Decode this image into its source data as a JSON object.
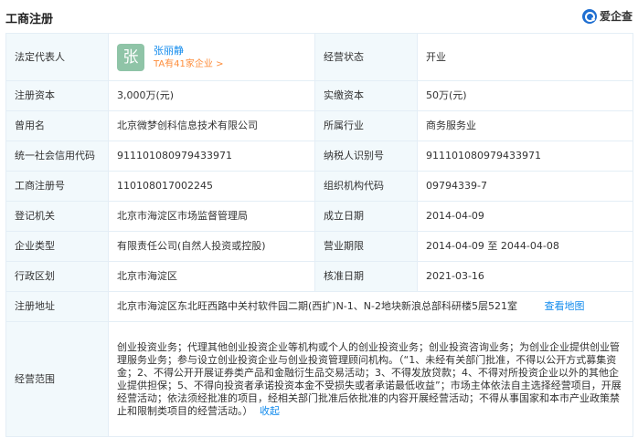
{
  "header": {
    "title": "工商注册",
    "brand": "爱企查",
    "brand_icon": "magnifier-logo-icon"
  },
  "rep": {
    "label": "法定代表人",
    "avatar_char": "张",
    "name": "张丽静",
    "companies_link": "TA有41家企业 >",
    "status_label": "经营状态",
    "status_value": "开业"
  },
  "rows": {
    "capital": {
      "l1": "注册资本",
      "v1": "3,000万(元)",
      "l2": "实缴资本",
      "v2": "50万(元)"
    },
    "former": {
      "l1": "曾用名",
      "v1": "北京微梦创科信息技术有限公司",
      "l2": "所属行业",
      "v2": "商务服务业"
    },
    "credit": {
      "l1": "统一社会信用代码",
      "v1": "911101080979433971",
      "l2": "纳税人识别号",
      "v2": "911101080979433971"
    },
    "regno": {
      "l1": "工商注册号",
      "v1": "110108017002245",
      "l2": "组织机构代码",
      "v2": "09794339-7"
    },
    "authority": {
      "l1": "登记机关",
      "v1": "北京市海淀区市场监督管理局",
      "l2": "成立日期",
      "v2": "2014-04-09"
    },
    "type": {
      "l1": "企业类型",
      "v1": "有限责任公司(自然人投资或控股)",
      "l2": "营业期限",
      "v2": "2014-04-09 至 2044-04-08"
    },
    "district": {
      "l1": "行政区划",
      "v1": "北京市海淀区",
      "l2": "核准日期",
      "v2": "2021-03-16"
    }
  },
  "address": {
    "label": "注册地址",
    "value": "北京市海淀区东北旺西路中关村软件园二期(西扩)N-1、N-2地块新浪总部科研楼5层521室",
    "map_link": "查看地图"
  },
  "scope": {
    "label": "经营范围",
    "text": "创业投资业务；代理其他创业投资企业等机构或个人的创业投资业务；创业投资咨询业务；为创业企业提供创业管理服务业务；参与设立创业投资企业与创业投资管理顾问机构。（“1、未经有关部门批准，不得以公开方式募集资金；2、不得公开开展证券类产品和金融衍生品交易活动；3、不得发放贷款；4、不得对所投资企业以外的其他企业提供担保；5、不得向投资者承诺投资本金不受损失或者承诺最低收益”；市场主体依法自主选择经营项目，开展经营活动；依法须经批准的项目，经相关部门批准后依批准的内容开展经营活动；不得从事国家和本市产业政策禁止和限制类项目的经营活动。）",
    "collapse": "收起"
  }
}
